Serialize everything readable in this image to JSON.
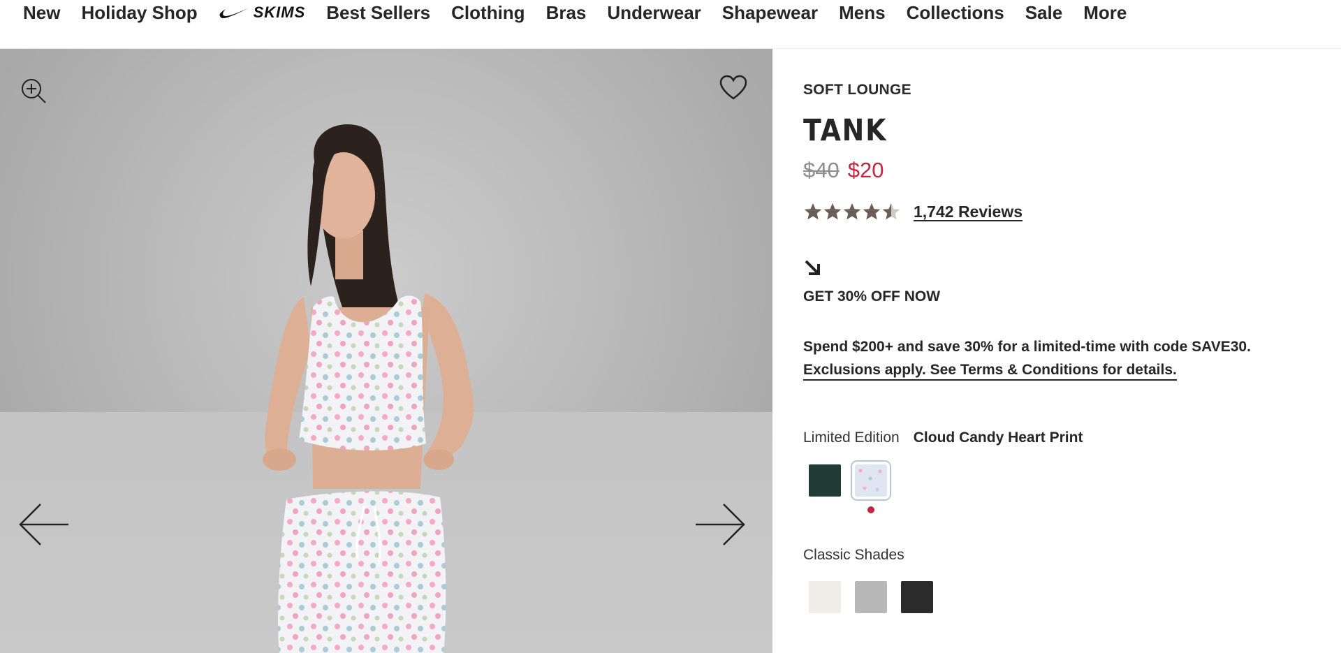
{
  "nav": {
    "items_left": [
      "New",
      "Holiday Shop"
    ],
    "logo": {
      "brand_text": "SKIMS",
      "icon": "nike-swoosh-icon"
    },
    "items_right": [
      "Best Sellers",
      "Clothing",
      "Bras",
      "Underwear",
      "Shapewear",
      "Mens",
      "Collections",
      "Sale",
      "More"
    ]
  },
  "gallery": {
    "zoom_icon": "zoom-in-icon",
    "wishlist_icon": "heart-icon",
    "prev_icon": "arrow-left-icon",
    "next_icon": "arrow-right-icon",
    "image_subject": "model-photo"
  },
  "product": {
    "collection": "SOFT LOUNGE",
    "title": "TANK",
    "price_original": "$40",
    "price_sale": "$20",
    "rating": 4.5,
    "rating_max": 5,
    "reviews_label": "1,742 Reviews"
  },
  "promo": {
    "arrow_icon": "arrow-down-right-icon",
    "heading": "GET 30% OFF NOW",
    "text": "Spend $200+ and save 30% for a limited-time with code SAVE30.",
    "link_text": "Exclusions apply. See Terms & Conditions for details."
  },
  "colors": {
    "limited_label": "Limited Edition",
    "selected_name": "Cloud Candy Heart Print",
    "limited_swatches": [
      {
        "name": "dark-green",
        "hex": "#1f3b34",
        "selected": false
      },
      {
        "name": "cloud-candy-heart-print",
        "hex": "#dfe6f1",
        "selected": true
      }
    ],
    "classic_label": "Classic Shades",
    "classic_swatches": [
      {
        "name": "bone",
        "hex": "#eeede8"
      },
      {
        "name": "heather-grey",
        "hex": "#b8b8b8"
      },
      {
        "name": "onyx",
        "hex": "#2b2b2b"
      }
    ]
  },
  "theme": {
    "sale_red": "#c0283f",
    "star_color": "#6b5e57",
    "text_dark": "#262626"
  }
}
